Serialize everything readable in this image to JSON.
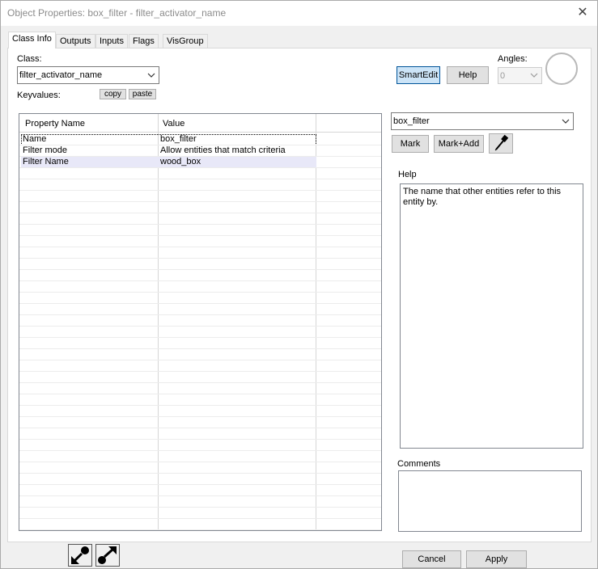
{
  "window": {
    "title": "Object Properties: box_filter - filter_activator_name",
    "close_glyph": "✕"
  },
  "tabs": [
    {
      "label": "Class Info",
      "active": true
    },
    {
      "label": "Outputs"
    },
    {
      "label": "Inputs"
    },
    {
      "label": "Flags"
    },
    {
      "label": "VisGroup"
    }
  ],
  "class_section": {
    "class_label": "Class:",
    "class_value": "filter_activator_name",
    "keyvalues_label": "Keyvalues:",
    "copy_label": "copy",
    "paste_label": "paste"
  },
  "toolbar": {
    "smartedit_label": "SmartEdit",
    "help_label": "Help",
    "angles_label": "Angles:",
    "angles_value": "0"
  },
  "grid": {
    "columns": [
      "Property Name",
      "Value"
    ],
    "rows": [
      {
        "name": "Name",
        "value": "box_filter"
      },
      {
        "name": "Filter mode",
        "value": "Allow entities that match criteria"
      },
      {
        "name": "Filter Name",
        "value": "wood_box"
      }
    ]
  },
  "right_panel": {
    "target_value": "box_filter",
    "mark_label": "Mark",
    "mark_add_label": "Mark+Add",
    "help_heading": "Help",
    "help_text": "The name that other entities refer to this entity by.",
    "comments_heading": "Comments",
    "comments_value": ""
  },
  "footer": {
    "cancel_label": "Cancel",
    "apply_label": "Apply"
  },
  "icons": {
    "dropdown": "chevron-down-icon",
    "eyedropper": "eyedropper-icon",
    "goto_source": "goto-source-icon",
    "goto_target": "goto-target-icon"
  }
}
